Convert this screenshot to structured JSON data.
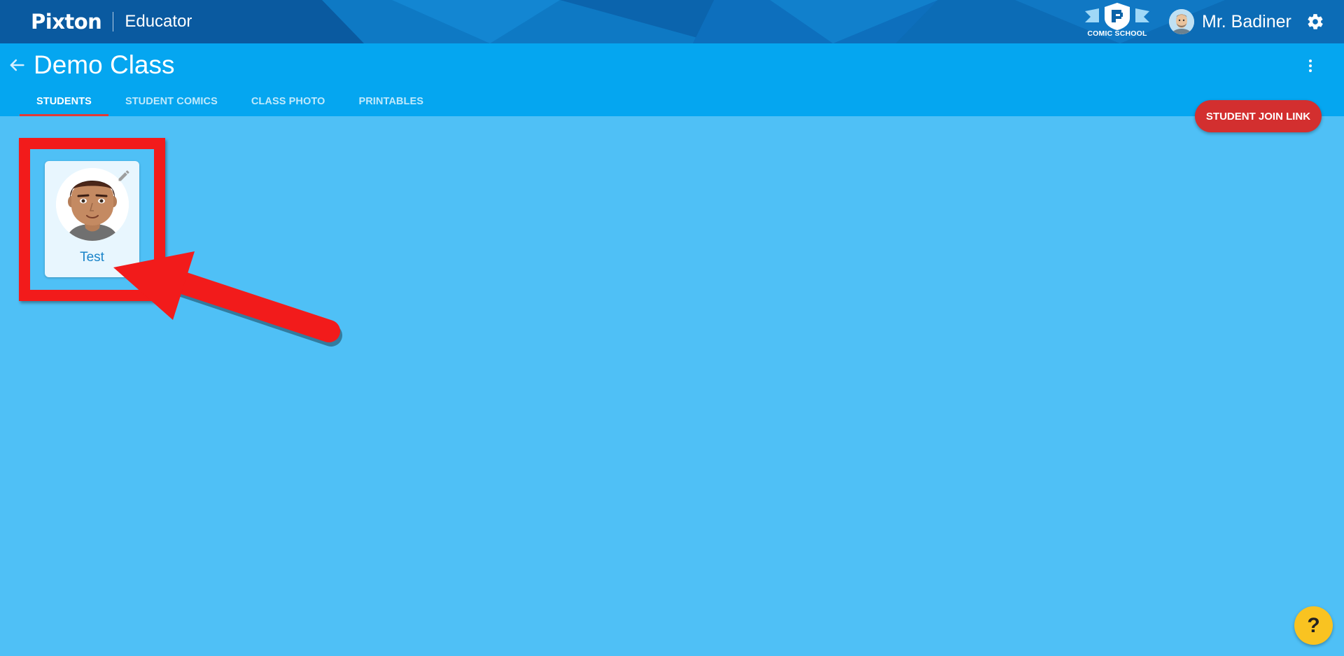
{
  "header": {
    "logo_text": "Pixton",
    "product_label": "Educator",
    "comic_school_label": "COMIC SCHOOL",
    "user_name": "Mr. Badiner",
    "icons": {
      "settings": "gear-icon",
      "avatar": "user-avatar"
    }
  },
  "page": {
    "title": "Demo Class",
    "back_icon": "arrow-left-icon",
    "menu_icon": "more-vertical-icon"
  },
  "tabs": [
    {
      "label": "STUDENTS",
      "active": true
    },
    {
      "label": "STUDENT COMICS",
      "active": false
    },
    {
      "label": "CLASS PHOTO",
      "active": false
    },
    {
      "label": "PRINTABLES",
      "active": false
    }
  ],
  "actions": {
    "join_link_label": "STUDENT JOIN LINK"
  },
  "students": [
    {
      "name": "Test",
      "edit_icon": "pencil-icon"
    }
  ],
  "help": {
    "label": "?"
  },
  "colors": {
    "header_dark": "#0a63a8",
    "subheader": "#05a6f0",
    "body": "#4fc0f6",
    "accent_red": "#d32f2f",
    "annotation": "#f21b1b",
    "help_yellow": "#f9c321"
  }
}
